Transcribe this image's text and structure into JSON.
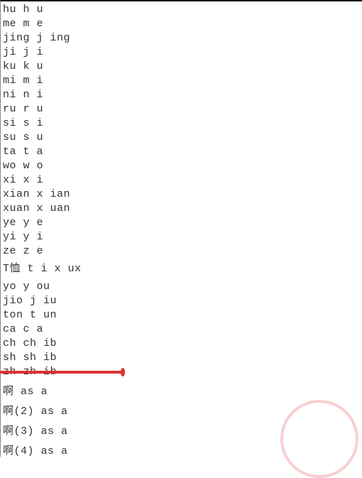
{
  "lines": {
    "l0": "hu h u",
    "l1": "me m e",
    "l2": "jing j ing",
    "l3": "ji j i",
    "l4": "ku k u",
    "l5": "mi m i",
    "l6": "ni n i",
    "l7": "ru r u",
    "l8": "si s i",
    "l9": "su s u",
    "l10": "ta t a",
    "l11": "wo w o",
    "l12": "xi x i",
    "l13": "xian x ian",
    "l14": "xuan x uan",
    "l15": "ye y e",
    "l16": "yi y i",
    "l17": "ze z e",
    "l18": "T恤 t i x ux",
    "l19": "yo y ou",
    "l20": "jio j iu",
    "l21": "ton t un",
    "l22": "ca c a",
    "l23": "ch ch ib",
    "l24": "sh sh ib",
    "l25": "zh zh ib",
    "l26": "啊 as a",
    "l27": "啊(2) as a",
    "l28": "啊(3) as a",
    "l29": "啊(4) as a"
  }
}
